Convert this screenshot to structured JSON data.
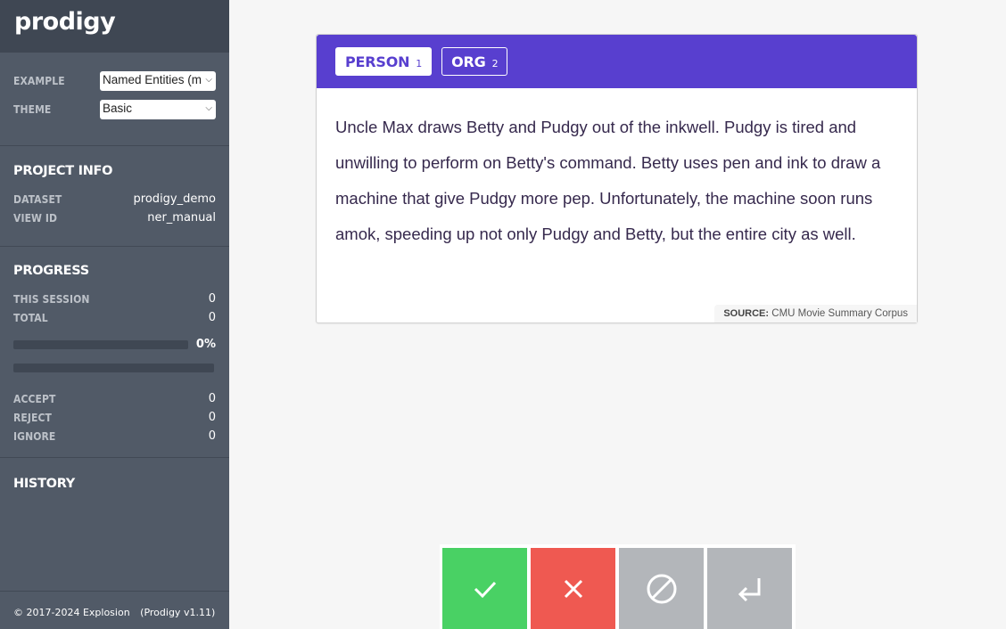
{
  "app": {
    "logo": "prodigy"
  },
  "settings": {
    "example_label": "EXAMPLE",
    "example_value": "Named Entities (m",
    "theme_label": "THEME",
    "theme_value": "Basic"
  },
  "project_info": {
    "title": "PROJECT INFO",
    "dataset_label": "DATASET",
    "dataset_value": "prodigy_demo",
    "view_id_label": "VIEW ID",
    "view_id_value": "ner_manual"
  },
  "progress": {
    "title": "PROGRESS",
    "this_session_label": "THIS SESSION",
    "this_session_value": "0",
    "total_label": "TOTAL",
    "total_value": "0",
    "percent": "0%",
    "progress_fraction": 0,
    "accept_label": "ACCEPT",
    "accept_value": "0",
    "reject_label": "REJECT",
    "reject_value": "0",
    "ignore_label": "IGNORE",
    "ignore_value": "0"
  },
  "history": {
    "title": "HISTORY"
  },
  "footer": {
    "copyright": "© 2017-2024 Explosion",
    "version": "(Prodigy v1.11)"
  },
  "labels": [
    {
      "name": "PERSON",
      "key": "1",
      "active": true
    },
    {
      "name": "ORG",
      "key": "2",
      "active": false
    }
  ],
  "task": {
    "text": "Uncle Max draws Betty and Pudgy out of the inkwell. Pudgy is tired and unwilling to perform on Betty's command. Betty uses pen and ink to draw a machine that give Pudgy more pep. Unfortunately, the machine soon runs amok, speeding up not only Pudgy and Betty, but the entire city as well.",
    "source_label": "SOURCE:",
    "source_value": "CMU Movie Summary Corpus"
  },
  "actions": [
    {
      "name": "accept",
      "icon": "check-icon",
      "color": "#49d164"
    },
    {
      "name": "reject",
      "icon": "cross-icon",
      "color": "#ef5951"
    },
    {
      "name": "ignore",
      "icon": "ignore-icon",
      "color": "#b3b6ba"
    },
    {
      "name": "undo",
      "icon": "undo-icon",
      "color": "#b3b6ba"
    }
  ],
  "colors": {
    "accent": "#583fcf",
    "sidebar": "#515a67",
    "sidebar_header": "#3f4753"
  }
}
